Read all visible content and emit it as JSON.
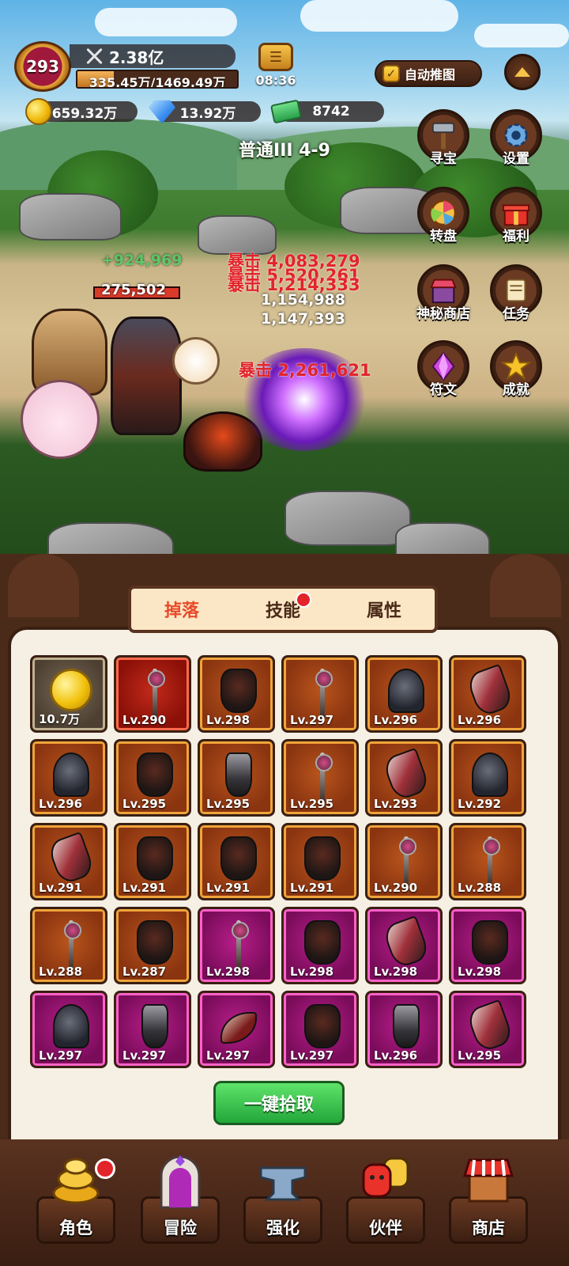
{
  "hud": {
    "player_level": "293",
    "power": "2.38亿",
    "exp_text": "335.45万/1469.49万",
    "exp_progress": 0.228,
    "timer": "08:36",
    "auto_push_label": "自动推图",
    "auto_push_checked": true
  },
  "currency": {
    "gold": "659.32万",
    "diamond": "13.92万",
    "cash": "8742"
  },
  "stage": "普通III 4-9",
  "side_menu": {
    "treasure": "寻宝",
    "settings": "设置",
    "wheel": "转盘",
    "welfare": "福利",
    "mystery_shop": "神秘商店",
    "tasks": "任务",
    "runes": "符文",
    "achievements": "成就"
  },
  "battle": {
    "heal": "+924,969",
    "ally_hp": "275,502",
    "crit_label": "暴击",
    "crit1": "4,083,279",
    "crit2": "5,520,261",
    "crit3": "1,214,333",
    "normal1": "1,154,988",
    "normal2": "1,147,393",
    "crit4": "2,261,621"
  },
  "panel": {
    "tabs": [
      "掉落",
      "技能",
      "属性"
    ],
    "active_tab": 0,
    "collect_button": "一键拾取"
  },
  "drops": [
    {
      "label": "10.7万",
      "rarity": "gray",
      "kind": "coin"
    },
    {
      "label": "Lv.290",
      "rarity": "red",
      "kind": "staff"
    },
    {
      "label": "Lv.298",
      "rarity": "orange",
      "kind": "armor"
    },
    {
      "label": "Lv.297",
      "rarity": "orange",
      "kind": "staff"
    },
    {
      "label": "Lv.296",
      "rarity": "orange",
      "kind": "helm"
    },
    {
      "label": "Lv.296",
      "rarity": "orange",
      "kind": "glove"
    },
    {
      "label": "Lv.296",
      "rarity": "orange",
      "kind": "helm"
    },
    {
      "label": "Lv.295",
      "rarity": "orange",
      "kind": "armor"
    },
    {
      "label": "Lv.295",
      "rarity": "orange",
      "kind": "boot"
    },
    {
      "label": "Lv.295",
      "rarity": "orange",
      "kind": "staff"
    },
    {
      "label": "Lv.293",
      "rarity": "orange",
      "kind": "glove"
    },
    {
      "label": "Lv.292",
      "rarity": "orange",
      "kind": "helm"
    },
    {
      "label": "Lv.291",
      "rarity": "orange",
      "kind": "glove"
    },
    {
      "label": "Lv.291",
      "rarity": "orange",
      "kind": "armor"
    },
    {
      "label": "Lv.291",
      "rarity": "orange",
      "kind": "armor"
    },
    {
      "label": "Lv.291",
      "rarity": "orange",
      "kind": "armor"
    },
    {
      "label": "Lv.290",
      "rarity": "orange",
      "kind": "staff"
    },
    {
      "label": "Lv.288",
      "rarity": "orange",
      "kind": "staff"
    },
    {
      "label": "Lv.288",
      "rarity": "orange",
      "kind": "staff"
    },
    {
      "label": "Lv.287",
      "rarity": "orange",
      "kind": "armor"
    },
    {
      "label": "Lv.298",
      "rarity": "magenta",
      "kind": "staff"
    },
    {
      "label": "Lv.298",
      "rarity": "magenta",
      "kind": "armor"
    },
    {
      "label": "Lv.298",
      "rarity": "magenta",
      "kind": "glove"
    },
    {
      "label": "Lv.298",
      "rarity": "magenta",
      "kind": "armor"
    },
    {
      "label": "Lv.297",
      "rarity": "magenta",
      "kind": "helm"
    },
    {
      "label": "Lv.297",
      "rarity": "magenta",
      "kind": "boot"
    },
    {
      "label": "Lv.297",
      "rarity": "magenta",
      "kind": "horn"
    },
    {
      "label": "Lv.297",
      "rarity": "magenta",
      "kind": "armor"
    },
    {
      "label": "Lv.296",
      "rarity": "magenta",
      "kind": "boot"
    },
    {
      "label": "Lv.295",
      "rarity": "magenta",
      "kind": "glove"
    }
  ],
  "bottom_nav": [
    "角色",
    "冒险",
    "强化",
    "伙伴",
    "商店"
  ],
  "colors": {
    "rarity_orange": "#b8541c",
    "rarity_red": "#c22a1a",
    "rarity_magenta": "#b81e8a",
    "rarity_gray": "#7a6a56",
    "crit_red": "#e3232a",
    "heal_green": "#3fd060",
    "button_green": "#22a73a"
  }
}
